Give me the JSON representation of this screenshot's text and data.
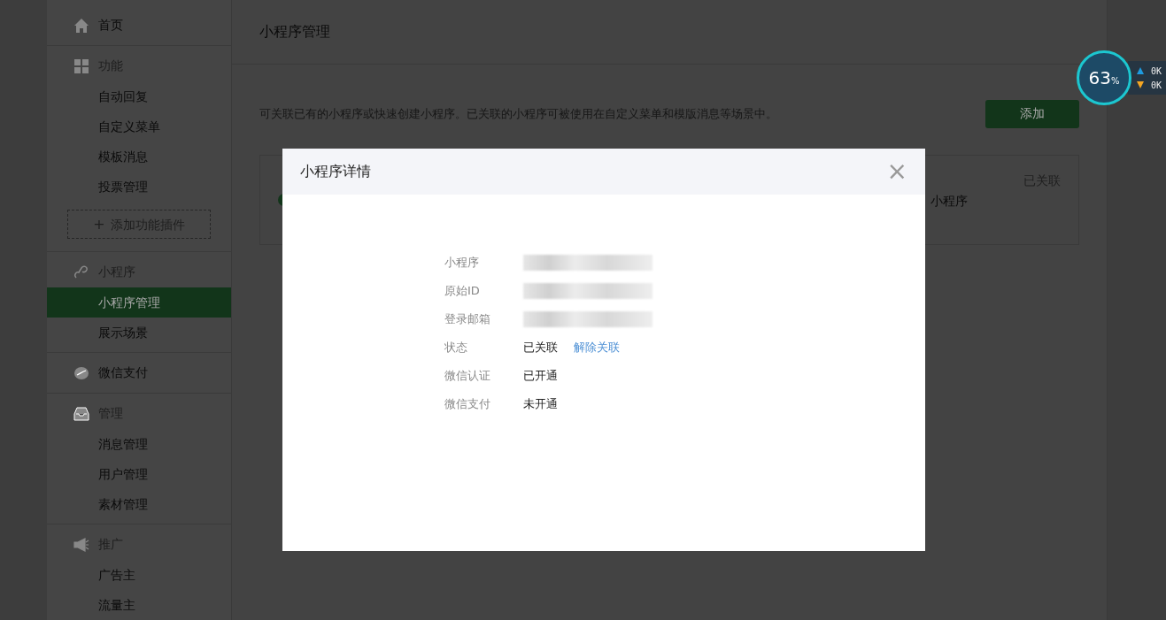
{
  "sidebar": {
    "sections": [
      {
        "kind": "home",
        "label": "首页"
      },
      {
        "kind": "grid",
        "label": "功能",
        "items": [
          {
            "label": "自动回复",
            "selected": false
          },
          {
            "label": "自定义菜单",
            "selected": false
          },
          {
            "label": "模板消息",
            "selected": false
          },
          {
            "label": "投票管理",
            "selected": false
          }
        ],
        "add_button": {
          "icon": "+",
          "label": "添加功能插件"
        }
      },
      {
        "kind": "link",
        "label": "小程序",
        "items": [
          {
            "label": "小程序管理",
            "selected": true
          },
          {
            "label": "展示场景",
            "selected": false
          }
        ]
      },
      {
        "kind": "pay",
        "label": "微信支付"
      },
      {
        "kind": "inbox",
        "label": "管理",
        "items": [
          {
            "label": "消息管理",
            "selected": false
          },
          {
            "label": "用户管理",
            "selected": false
          },
          {
            "label": "素材管理",
            "selected": false
          }
        ]
      },
      {
        "kind": "megaphone",
        "label": "推广",
        "items": [
          {
            "label": "广告主",
            "selected": false
          },
          {
            "label": "流量主",
            "selected": false
          }
        ]
      }
    ]
  },
  "main": {
    "title": "小程序管理",
    "description": "可关联已有的小程序或快速创建小程序。已关联的小程序可被使用在自定义菜单和模版消息等场景中。",
    "add_button": "添加",
    "card": {
      "name_tail": "小程序",
      "status": "已关联"
    }
  },
  "dialog": {
    "title": "小程序详情",
    "close": "×",
    "fields": [
      {
        "label": "小程序",
        "kind": "redacted"
      },
      {
        "label": "原始ID",
        "kind": "redacted"
      },
      {
        "label": "登录邮箱",
        "kind": "redacted"
      },
      {
        "label": "状态",
        "kind": "text",
        "value": "已关联",
        "link": "解除关联"
      },
      {
        "label": "微信认证",
        "kind": "text",
        "value": "已开通"
      },
      {
        "label": "微信支付",
        "kind": "text",
        "value": "未开通"
      }
    ]
  },
  "monitor": {
    "percent": "63",
    "unit": "%",
    "upload": "0K",
    "download": "0K"
  }
}
